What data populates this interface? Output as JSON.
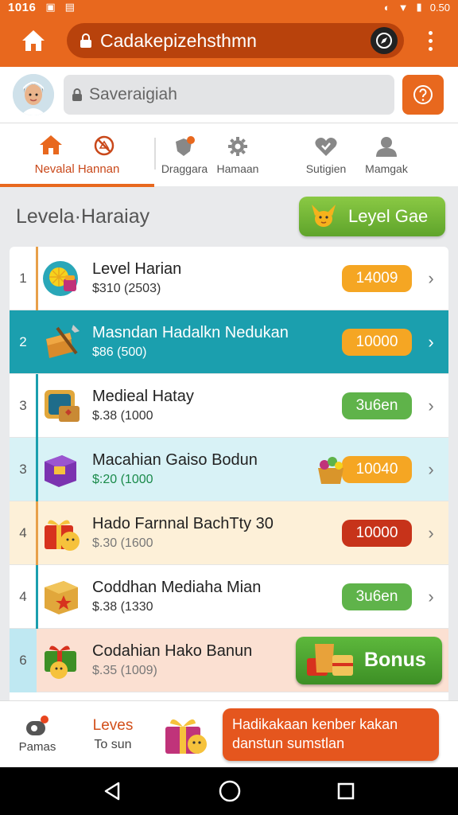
{
  "status_bar": {
    "time": "1016"
  },
  "appbar": {
    "url": "Cadakepizehsthmn"
  },
  "search": {
    "placeholder": "Saveraigiah"
  },
  "tabs": {
    "active_label": "Nevalal Hannan",
    "items": [
      {
        "label": "Draggara"
      },
      {
        "label": "Hamaan"
      },
      {
        "label": "Sutigien"
      },
      {
        "label": "Mamgak"
      }
    ]
  },
  "section": {
    "title": "Levela·Haraiay",
    "level_button": "Leyel Gae"
  },
  "rows": [
    {
      "rank": "1",
      "name": "Level Harian",
      "price": "$310  (2503)",
      "badge": "14009"
    },
    {
      "rank": "2",
      "name": "Masndan Hadalkn Nedukan",
      "price": "$86  (500)",
      "badge": "10000"
    },
    {
      "rank": "3",
      "name": "Medieal Hatay",
      "price": "$.38  (1000",
      "badge": "3u6en"
    },
    {
      "rank": "3",
      "name": "Macahian Gaiso Bodun",
      "price": "$:20  (1000",
      "badge": "10040"
    },
    {
      "rank": "4",
      "name": "Hado Farnnal BachTty 30",
      "price": "$.30  (1600",
      "badge": "10000"
    },
    {
      "rank": "4",
      "name": "Coddhan Mediaha Mian",
      "price": "$.38  (1330",
      "badge": "3u6en"
    },
    {
      "rank": "6",
      "name": "Codahian Hako Banun",
      "price": "$.35  (1009)",
      "badge": "Bonus"
    }
  ],
  "bottom_bar": {
    "pamas": "Pamas",
    "levels": "Leves",
    "levels_sub": "To sun",
    "cta": "Hadikakaan kenber kakan danstun sumstlan"
  },
  "colors": {
    "accent": "#e8681e",
    "teal": "#1b9fae",
    "green": "#5fb34a",
    "red": "#c7331a",
    "orange": "#f5a623"
  }
}
